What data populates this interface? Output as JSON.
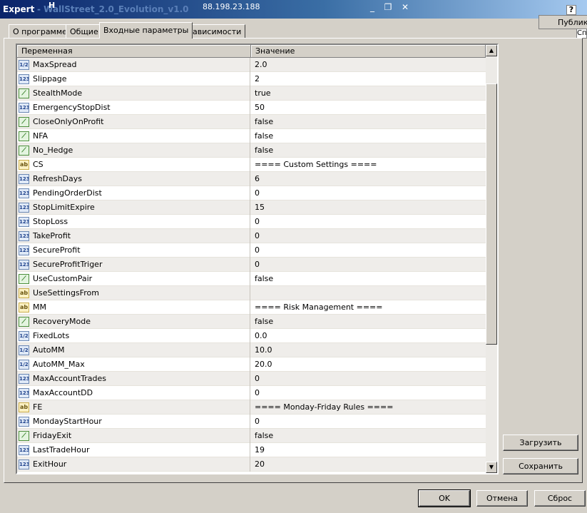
{
  "window": {
    "title": "Expert",
    "title_extra": "- WallStreet_2.0_Evolution_v1.0",
    "overlay_ip": "88.198.23.188",
    "overlay_h": "H",
    "minimize": "_",
    "restore": "❐",
    "close": "✕",
    "help": "?"
  },
  "popup": {
    "label": "Публик",
    "fragment": "Сп"
  },
  "tabs": [
    {
      "label": "О программе",
      "active": false
    },
    {
      "label": "Общие",
      "active": false
    },
    {
      "label": "Входные параметры",
      "active": true
    },
    {
      "label": "Зависимости",
      "active": false
    }
  ],
  "grid": {
    "col_variable": "Переменная",
    "col_value": "Значение",
    "rows": [
      {
        "type": "double",
        "icon": "1/2",
        "name": "MaxSpread",
        "value": "2.0"
      },
      {
        "type": "int",
        "icon": "123",
        "name": "Slippage",
        "value": "2"
      },
      {
        "type": "bool",
        "icon": "⟋",
        "name": "StealthMode",
        "value": "true"
      },
      {
        "type": "int",
        "icon": "123",
        "name": "EmergencyStopDist",
        "value": "50"
      },
      {
        "type": "bool",
        "icon": "⟋",
        "name": "CloseOnlyOnProfit",
        "value": "false"
      },
      {
        "type": "bool",
        "icon": "⟋",
        "name": "NFA",
        "value": "false"
      },
      {
        "type": "bool",
        "icon": "⟋",
        "name": "No_Hedge",
        "value": "false"
      },
      {
        "type": "string",
        "icon": "ab",
        "name": "CS",
        "value": "==== Custom Settings ===="
      },
      {
        "type": "int",
        "icon": "123",
        "name": "RefreshDays",
        "value": "6"
      },
      {
        "type": "int",
        "icon": "123",
        "name": "PendingOrderDist",
        "value": "0"
      },
      {
        "type": "int",
        "icon": "123",
        "name": "StopLimitExpire",
        "value": "15"
      },
      {
        "type": "int",
        "icon": "123",
        "name": "StopLoss",
        "value": "0"
      },
      {
        "type": "int",
        "icon": "123",
        "name": "TakeProfit",
        "value": "0"
      },
      {
        "type": "int",
        "icon": "123",
        "name": "SecureProfit",
        "value": "0"
      },
      {
        "type": "int",
        "icon": "123",
        "name": "SecureProfitTriger",
        "value": "0"
      },
      {
        "type": "bool",
        "icon": "⟋",
        "name": "UseCustomPair",
        "value": "false"
      },
      {
        "type": "string",
        "icon": "ab",
        "name": "UseSettingsFrom",
        "value": ""
      },
      {
        "type": "string",
        "icon": "ab",
        "name": "MM",
        "value": "==== Risk Management ===="
      },
      {
        "type": "bool",
        "icon": "⟋",
        "name": "RecoveryMode",
        "value": "false"
      },
      {
        "type": "double",
        "icon": "1/2",
        "name": "FixedLots",
        "value": "0.0"
      },
      {
        "type": "double",
        "icon": "1/2",
        "name": "AutoMM",
        "value": "10.0"
      },
      {
        "type": "double",
        "icon": "1/2",
        "name": "AutoMM_Max",
        "value": "20.0"
      },
      {
        "type": "int",
        "icon": "123",
        "name": "MaxAccountTrades",
        "value": "0"
      },
      {
        "type": "int",
        "icon": "123",
        "name": "MaxAccountDD",
        "value": "0"
      },
      {
        "type": "string",
        "icon": "ab",
        "name": "FE",
        "value": "==== Monday-Friday Rules ===="
      },
      {
        "type": "int",
        "icon": "123",
        "name": "MondayStartHour",
        "value": "0"
      },
      {
        "type": "bool",
        "icon": "⟋",
        "name": "FridayExit",
        "value": "false"
      },
      {
        "type": "int",
        "icon": "123",
        "name": "LastTradeHour",
        "value": "19"
      },
      {
        "type": "int",
        "icon": "123",
        "name": "ExitHour",
        "value": "20"
      }
    ]
  },
  "scrollbar": {
    "up": "▲",
    "down": "▼"
  },
  "buttons": {
    "load": "Загрузить",
    "save": "Сохранить",
    "ok": "OK",
    "cancel": "Отмена",
    "reset": "Сброс"
  }
}
